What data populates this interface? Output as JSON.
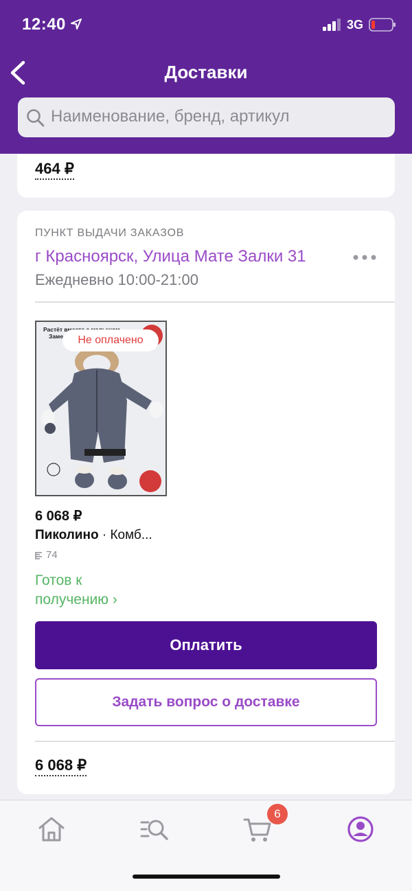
{
  "status_bar": {
    "time": "12:40",
    "network": "3G"
  },
  "header": {
    "title": "Доставки",
    "search_placeholder": "Наименование, бренд, артикул"
  },
  "previous_card": {
    "total": "464 ₽"
  },
  "delivery_card": {
    "pickup_label": "ПУНКТ ВЫДАЧИ ЗАКАЗОВ",
    "address": "г Красноярск, Улица Мате Залки 31",
    "hours": "Ежедневно 10:00-21:00",
    "product": {
      "badge": "Не оплачено",
      "price": "6 068 ₽",
      "brand": "Пиколино",
      "name_rest": " · Комб...",
      "size": "74",
      "status_line1": "Готов к",
      "status_line2": "получению ›",
      "image_caption_1": "Растёт вместе с малышом",
      "image_caption_2": "Замен..."
    },
    "pay_label": "Оплатить",
    "ask_label": "Задать вопрос о доставке",
    "total": "6 068 ₽"
  },
  "tabbar": {
    "items": [
      {
        "icon": "home-icon"
      },
      {
        "icon": "catalog-search-icon"
      },
      {
        "icon": "cart-icon",
        "badge": "6"
      },
      {
        "icon": "profile-icon"
      }
    ]
  },
  "colors": {
    "header_bg": "#5f2598",
    "accent_purple": "#9a4bc8",
    "pay_button": "#4c1193",
    "status_green": "#56b565",
    "unpaid_red": "#e23b3b",
    "badge_red": "#e8574a"
  }
}
